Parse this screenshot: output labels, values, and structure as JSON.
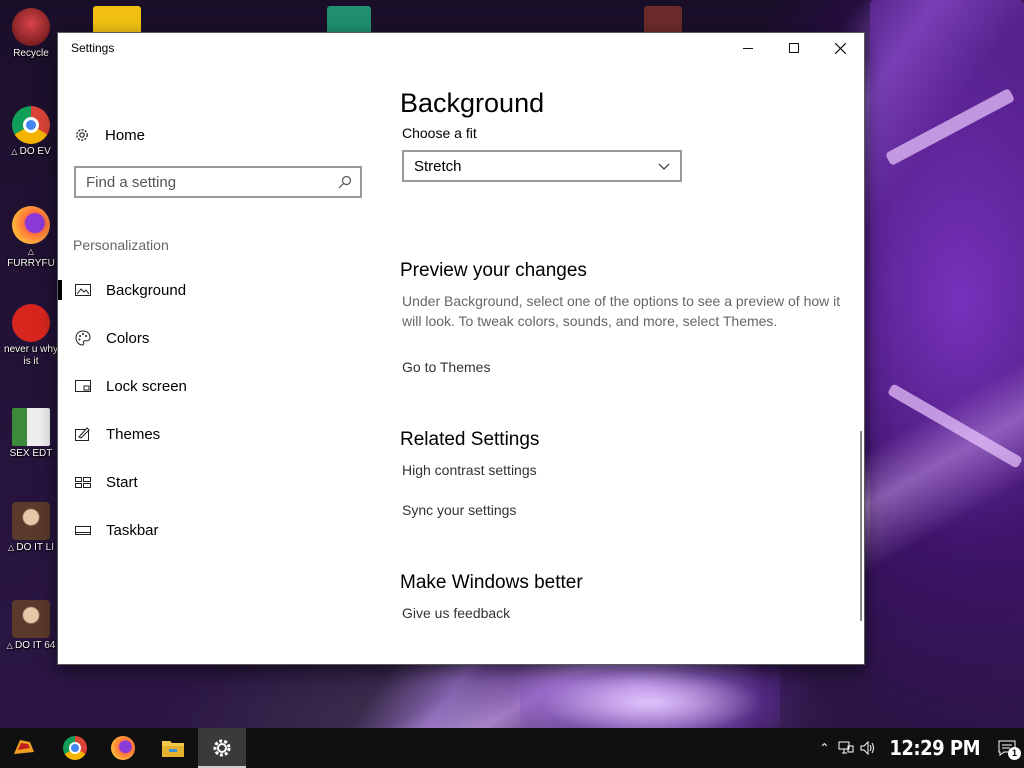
{
  "desktop": {
    "icons": [
      {
        "name": "recycle-bin-icon",
        "label": "Recycle",
        "color": "#c0282d"
      },
      {
        "name": "chrome-icon",
        "label": "DO EV",
        "color": "#2a7de1"
      },
      {
        "name": "firefox-icon",
        "label": "FURRYFU",
        "color": "#ff7139"
      },
      {
        "name": "devcpp-icon",
        "label": "never u why is it",
        "color": "#d7261e"
      },
      {
        "name": "hex-editor-icon",
        "label": "SEX EDT",
        "color": "#3b8b3b"
      },
      {
        "name": "portrait-icon",
        "label": "DO IT LI",
        "color": "#8a6a54"
      },
      {
        "name": "portrait-64-icon",
        "label": "DO IT 64",
        "color": "#8a6a54"
      }
    ]
  },
  "window": {
    "title": "Settings"
  },
  "nav": {
    "home_label": "Home",
    "search_placeholder": "Find a setting",
    "section_label": "Personalization",
    "items": [
      {
        "label": "Background",
        "icon": "picture-icon",
        "selected": true
      },
      {
        "label": "Colors",
        "icon": "palette-icon",
        "selected": false
      },
      {
        "label": "Lock screen",
        "icon": "lock-screen-icon",
        "selected": false
      },
      {
        "label": "Themes",
        "icon": "themes-icon",
        "selected": false
      },
      {
        "label": "Start",
        "icon": "start-icon",
        "selected": false
      },
      {
        "label": "Taskbar",
        "icon": "taskbar-icon",
        "selected": false
      }
    ]
  },
  "content": {
    "title": "Background",
    "fit_label": "Choose a fit",
    "fit_value": "Stretch",
    "preview_heading": "Preview your changes",
    "preview_text": "Under Background, select one of the options to see a preview of how it will look. To tweak colors, sounds, and more, select Themes.",
    "go_to_themes": "Go to Themes",
    "related_heading": "Related Settings",
    "related_links": [
      "High contrast settings",
      "Sync your settings"
    ],
    "better_heading": "Make Windows better",
    "feedback_link": "Give us feedback"
  },
  "taskbar": {
    "apps": [
      "start-icon",
      "chrome-icon",
      "firefox-icon",
      "file-explorer-icon",
      "settings-gear-icon"
    ],
    "clock": "12:29 PM",
    "notification_count": "1"
  }
}
